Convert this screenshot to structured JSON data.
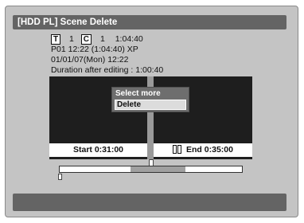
{
  "header": {
    "title": "[HDD PL] Scene Delete"
  },
  "info": {
    "title_icon": "T",
    "title_number": "1",
    "chapter_icon": "C",
    "chapter_number": "1",
    "total_time": "1:04:40",
    "playlist_line": "P01  12:22 (1:04:40) XP",
    "date_line": "01/01/07(Mon)  12:22",
    "duration_line": "Duration after editing : 1:00:40"
  },
  "menu": {
    "title": "Select more",
    "items": [
      "Delete"
    ]
  },
  "left_panel": {
    "label": "Start  0:31:00"
  },
  "right_panel": {
    "label": "End  0:35:00",
    "icon": "pause-icon"
  },
  "timeline": {
    "deleted_segment_start": 0.39,
    "deleted_segment_end": 0.69
  },
  "colors": {
    "screen_bg": "#c4c4c4",
    "bar": "#646464",
    "panel": "#1e1e1e",
    "menu": "#6e6e6e"
  }
}
